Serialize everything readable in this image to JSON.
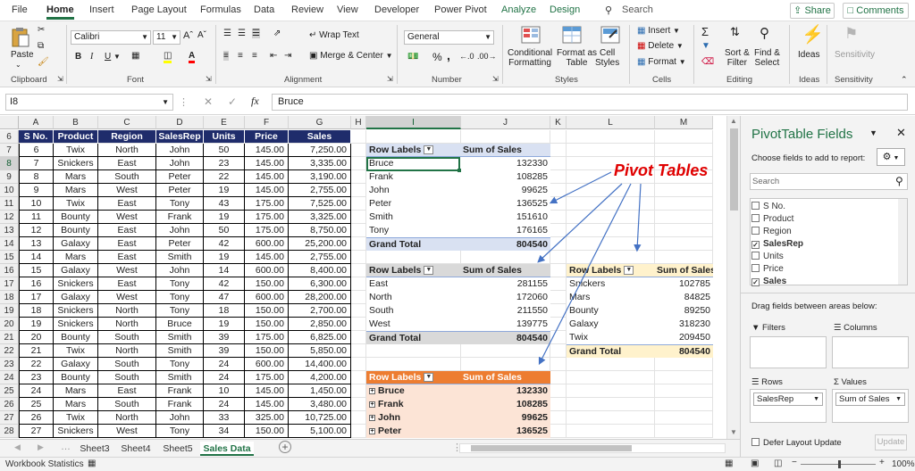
{
  "menu": {
    "items": [
      "File",
      "Home",
      "Insert",
      "Page Layout",
      "Formulas",
      "Data",
      "Review",
      "View",
      "Developer",
      "Power Pivot",
      "Analyze",
      "Design"
    ],
    "search": "Search",
    "share": "Share",
    "comments": "Comments"
  },
  "ribbon": {
    "clipboard": {
      "paste": "Paste",
      "label": "Clipboard"
    },
    "font": {
      "name": "Calibri",
      "size": "11",
      "label": "Font",
      "bold": "B",
      "italic": "I",
      "underline": "U"
    },
    "alignment": {
      "wrap": "Wrap Text",
      "merge": "Merge & Center",
      "label": "Alignment"
    },
    "number": {
      "format": "General",
      "label": "Number"
    },
    "styles": {
      "conditional": "Conditional\nFormatting",
      "format_table": "Format as\nTable",
      "cell_styles": "Cell\nStyles",
      "label": "Styles"
    },
    "cells": {
      "insert": "Insert",
      "delete": "Delete",
      "format": "Format",
      "label": "Cells"
    },
    "editing": {
      "sort": "Sort &\nFilter",
      "find": "Find &\nSelect",
      "label": "Editing"
    },
    "ideas": {
      "name": "Ideas",
      "label": "Ideas"
    },
    "sensitivity": {
      "name": "Sensitivity",
      "label": "Sensitivity"
    }
  },
  "formula_bar": {
    "name_box": "I8",
    "formula": "Bruce"
  },
  "columns": [
    "A",
    "B",
    "C",
    "D",
    "E",
    "F",
    "G",
    "H",
    "I",
    "J",
    "K",
    "L",
    "M"
  ],
  "rows": [
    "6",
    "7",
    "8",
    "9",
    "10",
    "11",
    "12",
    "13",
    "14",
    "15",
    "16",
    "17",
    "18",
    "19",
    "20",
    "21",
    "22",
    "23",
    "24",
    "25",
    "26",
    "27",
    "28"
  ],
  "table_headers": [
    "S No.",
    "Product",
    "Region",
    "SalesRep",
    "Units",
    "Price",
    "Sales"
  ],
  "table_rows": [
    [
      "6",
      "Twix",
      "North",
      "John",
      "50",
      "145.00",
      "7,250.00"
    ],
    [
      "7",
      "Snickers",
      "East",
      "John",
      "23",
      "145.00",
      "3,335.00"
    ],
    [
      "8",
      "Mars",
      "South",
      "Peter",
      "22",
      "145.00",
      "3,190.00"
    ],
    [
      "9",
      "Mars",
      "West",
      "Peter",
      "19",
      "145.00",
      "2,755.00"
    ],
    [
      "10",
      "Twix",
      "East",
      "Tony",
      "43",
      "175.00",
      "7,525.00"
    ],
    [
      "11",
      "Bounty",
      "West",
      "Frank",
      "19",
      "175.00",
      "3,325.00"
    ],
    [
      "12",
      "Bounty",
      "East",
      "John",
      "50",
      "175.00",
      "8,750.00"
    ],
    [
      "13",
      "Galaxy",
      "East",
      "Peter",
      "42",
      "600.00",
      "25,200.00"
    ],
    [
      "14",
      "Mars",
      "East",
      "Smith",
      "19",
      "145.00",
      "2,755.00"
    ],
    [
      "15",
      "Galaxy",
      "West",
      "John",
      "14",
      "600.00",
      "8,400.00"
    ],
    [
      "16",
      "Snickers",
      "East",
      "Tony",
      "42",
      "150.00",
      "6,300.00"
    ],
    [
      "17",
      "Galaxy",
      "West",
      "Tony",
      "47",
      "600.00",
      "28,200.00"
    ],
    [
      "18",
      "Snickers",
      "North",
      "Tony",
      "18",
      "150.00",
      "2,700.00"
    ],
    [
      "19",
      "Snickers",
      "North",
      "Bruce",
      "19",
      "150.00",
      "2,850.00"
    ],
    [
      "20",
      "Bounty",
      "South",
      "Smith",
      "39",
      "175.00",
      "6,825.00"
    ],
    [
      "21",
      "Twix",
      "North",
      "Smith",
      "39",
      "150.00",
      "5,850.00"
    ],
    [
      "22",
      "Galaxy",
      "South",
      "Tony",
      "24",
      "600.00",
      "14,400.00"
    ],
    [
      "23",
      "Bounty",
      "South",
      "Smith",
      "24",
      "175.00",
      "4,200.00"
    ],
    [
      "24",
      "Mars",
      "East",
      "Frank",
      "10",
      "145.00",
      "1,450.00"
    ],
    [
      "25",
      "Mars",
      "South",
      "Frank",
      "24",
      "145.00",
      "3,480.00"
    ],
    [
      "26",
      "Twix",
      "North",
      "John",
      "33",
      "325.00",
      "10,725.00"
    ],
    [
      "27",
      "Snickers",
      "West",
      "Tony",
      "34",
      "150.00",
      "5,100.00"
    ]
  ],
  "pivot1": {
    "header": "Row Labels",
    "value_header": "Sum of Sales",
    "rows": [
      [
        "Bruce",
        "132330"
      ],
      [
        "Frank",
        "108285"
      ],
      [
        "John",
        "99625"
      ],
      [
        "Peter",
        "136525"
      ],
      [
        "Smith",
        "151610"
      ],
      [
        "Tony",
        "176165"
      ]
    ],
    "total": [
      "Grand Total",
      "804540"
    ]
  },
  "pivot2": {
    "header": "Row Labels",
    "value_header": "Sum of Sales",
    "rows": [
      [
        "East",
        "281155"
      ],
      [
        "North",
        "172060"
      ],
      [
        "South",
        "211550"
      ],
      [
        "West",
        "139775"
      ]
    ],
    "total": [
      "Grand Total",
      "804540"
    ]
  },
  "pivot3": {
    "header": "Row Labels",
    "value_header": "Sum of Sales",
    "rows": [
      [
        "Snickers",
        "102785"
      ],
      [
        "Mars",
        "84825"
      ],
      [
        "Bounty",
        "89250"
      ],
      [
        "Galaxy",
        "318230"
      ],
      [
        "Twix",
        "209450"
      ]
    ],
    "total": [
      "Grand Total",
      "804540"
    ]
  },
  "pivot4": {
    "header": "Row Labels",
    "value_header": "Sum of Sales",
    "rows": [
      [
        "Bruce",
        "132330"
      ],
      [
        "Frank",
        "108285"
      ],
      [
        "John",
        "99625"
      ],
      [
        "Peter",
        "136525"
      ]
    ]
  },
  "annotation": "Pivot Tables",
  "pane": {
    "title": "PivotTable Fields",
    "subtitle": "Choose fields to add to report:",
    "search": "Search",
    "fields": [
      {
        "name": "S No.",
        "checked": false
      },
      {
        "name": "Product",
        "checked": false
      },
      {
        "name": "Region",
        "checked": false
      },
      {
        "name": "SalesRep",
        "checked": true
      },
      {
        "name": "Units",
        "checked": false
      },
      {
        "name": "Price",
        "checked": false
      },
      {
        "name": "Sales",
        "checked": true
      }
    ],
    "drag_label": "Drag fields between areas below:",
    "filters": "Filters",
    "columns": "Columns",
    "rows": "Rows",
    "values": "Values",
    "rows_item": "SalesRep",
    "values_item": "Sum of Sales",
    "defer": "Defer Layout Update",
    "update": "Update"
  },
  "sheet_tabs": [
    "Sheet3",
    "Sheet4",
    "Sheet5",
    "Sales Data"
  ],
  "active_tab": "Sales Data",
  "status": {
    "left": "Workbook Statistics",
    "zoom": "100%"
  },
  "colors": {
    "accent": "#217346",
    "table_header": "#1f2c6b",
    "pivot1": "#d9e1f2",
    "pivot2": "#d9d9d9",
    "pivot3": "#fff2cc",
    "pivot4_header": "#ed7d31",
    "pivot4_rows": "#fce4d6",
    "annotation": "#e00000"
  }
}
